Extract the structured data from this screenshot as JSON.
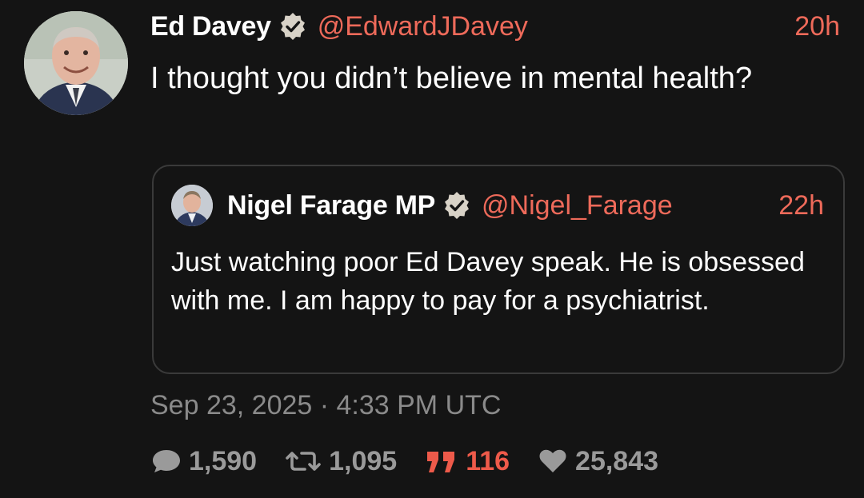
{
  "tweet": {
    "author_name": "Ed Davey",
    "author_handle": "@EdwardJDavey",
    "time_ago": "20h",
    "text": "I thought you didn’t believe in mental health?",
    "timestamp": "Sep 23, 2025 · 4:33 PM UTC"
  },
  "quoted_tweet": {
    "author_name": "Nigel Farage MP",
    "author_handle": "@Nigel_Farage",
    "time_ago": "22h",
    "text": "Just watching poor Ed Davey speak. He is obsessed with me. I am happy to pay for a psychiatrist."
  },
  "stats": {
    "replies": "1,590",
    "retweets": "1,095",
    "quotes": "116",
    "likes": "25,843"
  },
  "icons": {
    "verified": "verified-badge-icon",
    "reply": "comment-bubble-icon",
    "retweet": "retweet-icon",
    "quote": "quote-icon",
    "like": "heart-icon"
  },
  "colors": {
    "background": "#141414",
    "accent": "#ee6a5a",
    "quote_accent": "#ee5a4a",
    "muted": "#8a8a8a"
  }
}
